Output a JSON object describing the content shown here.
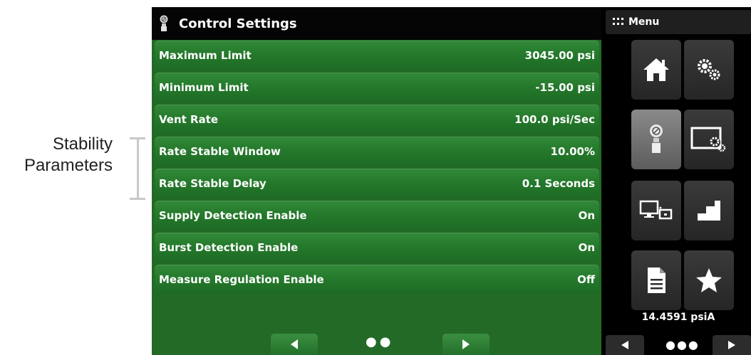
{
  "annotation": {
    "line1": "Stability",
    "line2": "Parameters"
  },
  "screen": {
    "title": "Control Settings",
    "rows": [
      {
        "label": "Maximum Limit",
        "value": "3045.00 psi"
      },
      {
        "label": "Minimum Limit",
        "value": "-15.00 psi"
      },
      {
        "label": "Vent Rate",
        "value": "100.0 psi/Sec"
      },
      {
        "label": "Rate Stable Window",
        "value": "10.00%"
      },
      {
        "label": "Rate Stable Delay",
        "value": "0.1 Seconds"
      },
      {
        "label": "Supply Detection Enable",
        "value": "On"
      },
      {
        "label": "Burst Detection Enable",
        "value": "On"
      },
      {
        "label": "Measure Regulation Enable",
        "value": "Off"
      }
    ],
    "page_indicator": "●●"
  },
  "sidebar": {
    "menu_label": "Menu",
    "tiles": [
      {
        "icon": "home-icon"
      },
      {
        "icon": "settings-gears-icon"
      },
      {
        "icon": "control-valve-icon",
        "active": true
      },
      {
        "icon": "display-settings-icon"
      },
      {
        "icon": "remote-devices-icon"
      },
      {
        "icon": "step-program-icon"
      },
      {
        "icon": "document-icon"
      },
      {
        "icon": "star-icon"
      }
    ],
    "reading": "14.4591 psiA",
    "page_indicator": "●●●"
  },
  "colors": {
    "row_green": "#257a2c",
    "panel_green": "#236a27",
    "title_bar": "#050505",
    "sidebar_bg": "#000000",
    "tile_bg": "#2e2e2e",
    "tile_active": "#757575"
  }
}
